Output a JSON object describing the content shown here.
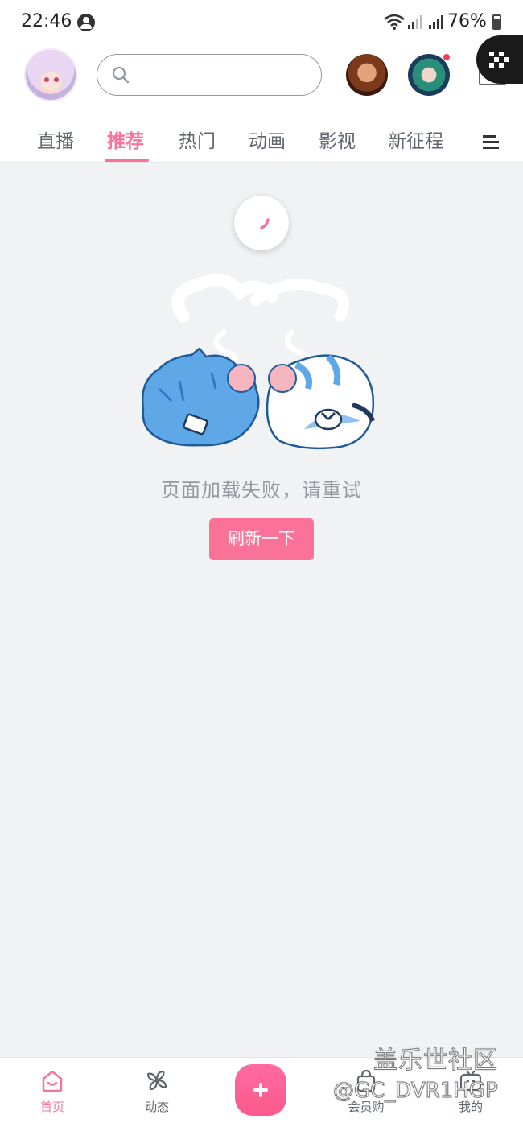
{
  "status_bar": {
    "time": "22:46",
    "battery": "76%"
  },
  "header": {
    "search": {
      "placeholder": ""
    },
    "tabs": [
      {
        "label": "直播"
      },
      {
        "label": "推荐",
        "active": true
      },
      {
        "label": "热门"
      },
      {
        "label": "动画"
      },
      {
        "label": "影视"
      },
      {
        "label": "新征程"
      }
    ]
  },
  "content": {
    "error_message": "页面加载失败，请重试",
    "refresh_label": "刷新一下"
  },
  "bottom_nav": {
    "items": [
      {
        "label": "首页",
        "icon": "home-icon",
        "active": true
      },
      {
        "label": "动态",
        "icon": "pinwheel-icon"
      },
      {
        "label": "会员购",
        "icon": "shopping-bag-icon"
      },
      {
        "label": "我的",
        "icon": "tv-profile-icon"
      }
    ]
  },
  "watermark": {
    "line1": "盖乐世社区",
    "line2": "@GC_DVR1HGP"
  },
  "colors": {
    "accent": "#fb7299",
    "background": "#f1f2f4",
    "text_secondary": "#9499a0",
    "notification_dot": "#ff3b4e"
  }
}
